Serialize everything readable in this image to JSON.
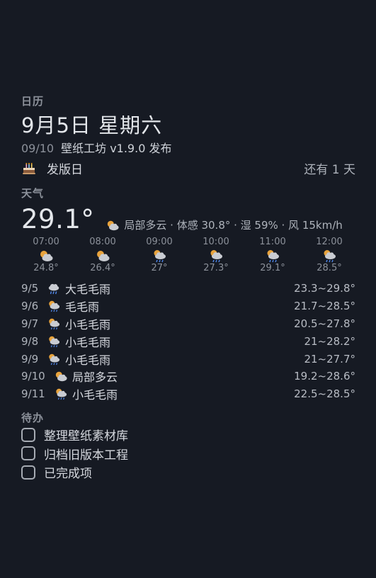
{
  "calendar": {
    "title": "日历",
    "date_main": "9月5日 星期六",
    "release_date": "09/10",
    "release_text": "壁纸工坊 v1.9.0 发布",
    "event_icon": "cake-icon",
    "event_name": "发版日",
    "event_countdown": "还有 1 天"
  },
  "weather": {
    "title": "天气",
    "now_temp": "29.1°",
    "now_icon": "partly-cloudy-icon",
    "now_desc": "局部多云 · 体感 30.8° · 湿 59% · 风 15km/h",
    "hourly": [
      {
        "time": "07:00",
        "icon": "partly-cloudy-icon",
        "temp": "24.8°"
      },
      {
        "time": "08:00",
        "icon": "partly-cloudy-icon",
        "temp": "26.4°"
      },
      {
        "time": "09:00",
        "icon": "drizzle-icon",
        "temp": "27°"
      },
      {
        "time": "10:00",
        "icon": "drizzle-icon",
        "temp": "27.3°"
      },
      {
        "time": "11:00",
        "icon": "drizzle-icon",
        "temp": "29.1°"
      },
      {
        "time": "12:00",
        "icon": "drizzle-icon",
        "temp": "28.5°"
      }
    ],
    "daily": [
      {
        "date": "9/5",
        "icon": "heavy-drizzle-icon",
        "desc": "大毛毛雨",
        "range": "23.3~29.8°"
      },
      {
        "date": "9/6",
        "icon": "drizzle-icon",
        "desc": "毛毛雨",
        "range": "21.7~28.5°"
      },
      {
        "date": "9/7",
        "icon": "drizzle-icon",
        "desc": "小毛毛雨",
        "range": "20.5~27.8°"
      },
      {
        "date": "9/8",
        "icon": "drizzle-icon",
        "desc": "小毛毛雨",
        "range": "21~28.2°"
      },
      {
        "date": "9/9",
        "icon": "drizzle-icon",
        "desc": "小毛毛雨",
        "range": "21~27.7°"
      },
      {
        "date": "9/10",
        "icon": "partly-cloudy-icon",
        "desc": "局部多云",
        "range": "19.2~28.6°"
      },
      {
        "date": "9/11",
        "icon": "drizzle-icon",
        "desc": "小毛毛雨",
        "range": "22.5~28.5°"
      }
    ]
  },
  "todo": {
    "title": "待办",
    "items": [
      {
        "label": "整理壁纸素材库",
        "checked": false
      },
      {
        "label": "归档旧版本工程",
        "checked": false
      },
      {
        "label": "已完成项",
        "checked": false
      }
    ]
  },
  "colors": {
    "background": "#161a23",
    "cloud": "#c9ccd2",
    "sun": "#e8a33c",
    "rain": "#4f86e8"
  }
}
